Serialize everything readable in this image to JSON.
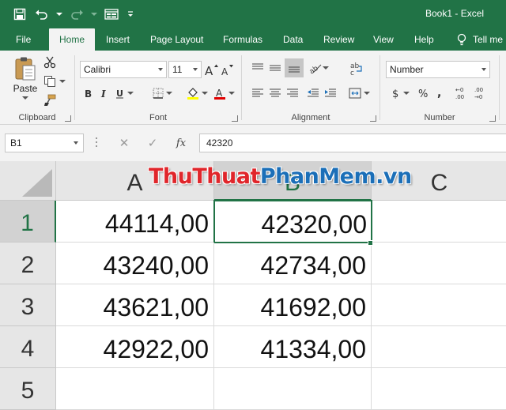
{
  "title": {
    "text": "Book1  -  Excel"
  },
  "tabs": [
    {
      "label": "File"
    },
    {
      "label": "Home"
    },
    {
      "label": "Insert"
    },
    {
      "label": "Page Layout"
    },
    {
      "label": "Formulas"
    },
    {
      "label": "Data"
    },
    {
      "label": "Review"
    },
    {
      "label": "View"
    },
    {
      "label": "Help"
    }
  ],
  "tell_me": {
    "label": "Tell me"
  },
  "ribbon": {
    "clipboard": {
      "label": "Clipboard",
      "paste_label": "Paste"
    },
    "font": {
      "label": "Font",
      "font_name": "Calibri",
      "font_size": "11"
    },
    "alignment": {
      "label": "Alignment"
    },
    "number": {
      "label": "Number",
      "format": "Number"
    }
  },
  "formula_bar": {
    "name_box": "B1",
    "fx_label": "fx",
    "content": "42320"
  },
  "grid": {
    "columns": [
      "A",
      "B",
      "C"
    ],
    "rows": [
      "1",
      "2",
      "3",
      "4",
      "5"
    ],
    "cells": [
      [
        "44114,00",
        "42320,00",
        ""
      ],
      [
        "43240,00",
        "42734,00",
        ""
      ],
      [
        "43621,00",
        "41692,00",
        ""
      ],
      [
        "42922,00",
        "41334,00",
        ""
      ],
      [
        "",
        "",
        ""
      ]
    ]
  },
  "watermark": {
    "part1": "ThuThuat",
    "part2": "PhanMem.vn"
  },
  "colors": {
    "accent": "#217346",
    "ribbon_bg": "#f3f3f3",
    "header_bg": "#e6e6e6",
    "watermark_red": "#e0262b",
    "watermark_blue": "#1b6fb8"
  }
}
